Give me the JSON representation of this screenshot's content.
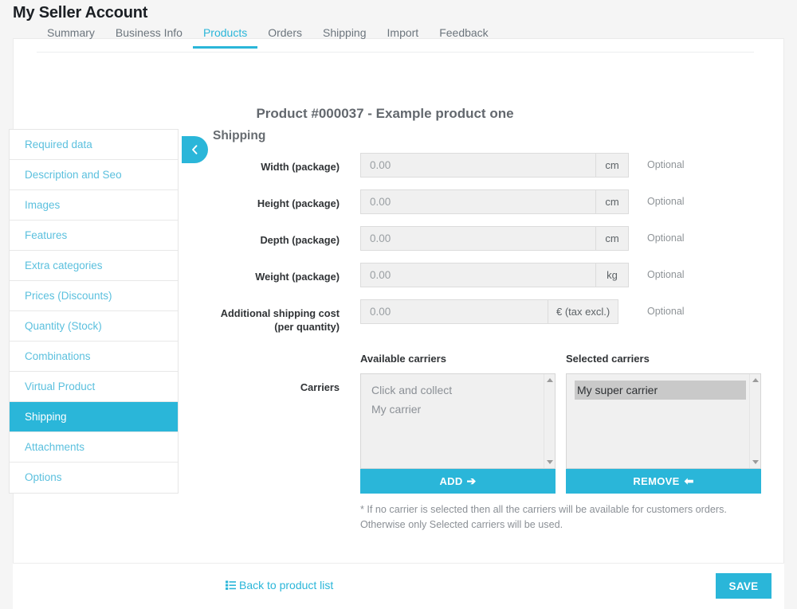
{
  "header": {
    "title": "My Seller Account"
  },
  "tabs": [
    {
      "label": "Summary",
      "active": false
    },
    {
      "label": "Business Info",
      "active": false
    },
    {
      "label": "Products",
      "active": true
    },
    {
      "label": "Orders",
      "active": false
    },
    {
      "label": "Shipping",
      "active": false
    },
    {
      "label": "Import",
      "active": false
    },
    {
      "label": "Feedback",
      "active": false
    }
  ],
  "product": {
    "headline": "Product #000037 - Example product one"
  },
  "sidebar": {
    "items": [
      {
        "label": "Required data",
        "active": false
      },
      {
        "label": "Description and Seo",
        "active": false
      },
      {
        "label": "Images",
        "active": false
      },
      {
        "label": "Features",
        "active": false
      },
      {
        "label": "Extra categories",
        "active": false
      },
      {
        "label": "Prices (Discounts)",
        "active": false
      },
      {
        "label": "Quantity (Stock)",
        "active": false
      },
      {
        "label": "Combinations",
        "active": false
      },
      {
        "label": "Virtual Product",
        "active": false
      },
      {
        "label": "Shipping",
        "active": true
      },
      {
        "label": "Attachments",
        "active": false
      },
      {
        "label": "Options",
        "active": false
      }
    ]
  },
  "collapse_button": {
    "icon": "chevron-left-icon"
  },
  "form": {
    "section_title": "Shipping",
    "fields": [
      {
        "label": "Width (package)",
        "value": "0.00",
        "placeholder": "0.00",
        "unit": "cm",
        "hint": "Optional"
      },
      {
        "label": "Height (package)",
        "value": "0.00",
        "placeholder": "0.00",
        "unit": "cm",
        "hint": "Optional"
      },
      {
        "label": "Depth (package)",
        "value": "0.00",
        "placeholder": "0.00",
        "unit": "cm",
        "hint": "Optional"
      },
      {
        "label": "Weight (package)",
        "value": "0.00",
        "placeholder": "0.00",
        "unit": "kg",
        "hint": "Optional"
      }
    ],
    "cost_field": {
      "label_line1": "Additional shipping cost",
      "label_line2": "(per quantity)",
      "value": "0.00",
      "placeholder": "0.00",
      "unit": "€ (tax excl.)",
      "hint": "Optional"
    }
  },
  "carriers": {
    "row_label": "Carriers",
    "available": {
      "title": "Available carriers",
      "options": [
        {
          "label": "Click and collect",
          "selected": false
        },
        {
          "label": "My carrier",
          "selected": false
        }
      ],
      "button_label": "ADD",
      "button_glyph": "➔"
    },
    "selected": {
      "title": "Selected carriers",
      "options": [
        {
          "label": "My super carrier",
          "selected": true
        }
      ],
      "button_label": "REMOVE",
      "button_glyph": "⬅"
    },
    "note_line1": "* If no carrier is selected then all the carriers will be available for customers orders.",
    "note_line2": "Otherwise only Selected carriers will be used."
  },
  "footer": {
    "back_label": "Back to product list",
    "save_label": "SAVE"
  },
  "colors": {
    "accent": "#2ab6d9",
    "link": "#5bc0de",
    "input_bg": "#f0f0f0",
    "selected_option_bg": "#c9c9c9",
    "page_bg": "#f5f5f5"
  }
}
